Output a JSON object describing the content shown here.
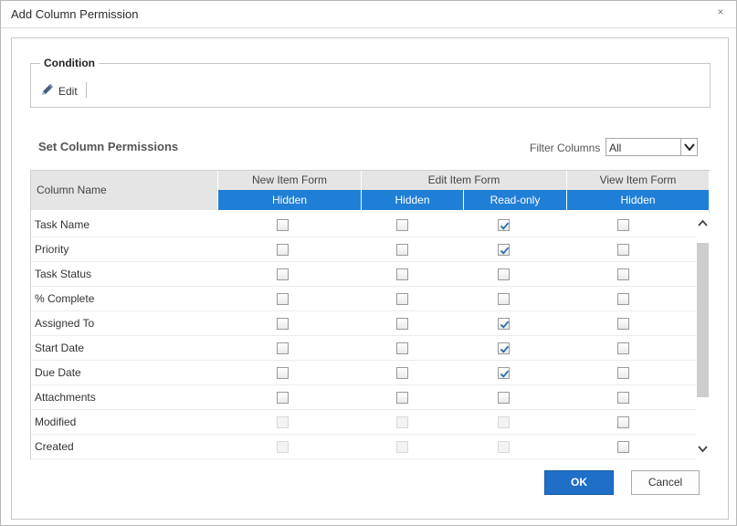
{
  "dialog": {
    "title": "Add Column Permission",
    "close_glyph": "×"
  },
  "condition": {
    "legend": "Condition",
    "edit_label": "Edit",
    "edit_icon": "pencil-icon"
  },
  "section": {
    "title": "Set Column Permissions",
    "filter_label": "Filter Columns",
    "filter_value": "All"
  },
  "grid": {
    "column_name_header": "Column Name",
    "groups": [
      "New Item Form",
      "Edit Item Form",
      "View Item Form"
    ],
    "subheaders": [
      "Hidden",
      "Hidden",
      "Read-only",
      "Hidden"
    ],
    "rows": [
      {
        "label": "Task Name",
        "checks": [
          false,
          false,
          true,
          false
        ],
        "disabled": [
          false,
          false,
          false,
          false
        ]
      },
      {
        "label": "Priority",
        "checks": [
          false,
          false,
          true,
          false
        ],
        "disabled": [
          false,
          false,
          false,
          false
        ]
      },
      {
        "label": "Task Status",
        "checks": [
          false,
          false,
          false,
          false
        ],
        "disabled": [
          false,
          false,
          false,
          false
        ]
      },
      {
        "label": "% Complete",
        "checks": [
          false,
          false,
          false,
          false
        ],
        "disabled": [
          false,
          false,
          false,
          false
        ]
      },
      {
        "label": "Assigned To",
        "checks": [
          false,
          false,
          true,
          false
        ],
        "disabled": [
          false,
          false,
          false,
          false
        ]
      },
      {
        "label": "Start Date",
        "checks": [
          false,
          false,
          true,
          false
        ],
        "disabled": [
          false,
          false,
          false,
          false
        ]
      },
      {
        "label": "Due Date",
        "checks": [
          false,
          false,
          true,
          false
        ],
        "disabled": [
          false,
          false,
          false,
          false
        ]
      },
      {
        "label": "Attachments",
        "checks": [
          false,
          false,
          false,
          false
        ],
        "disabled": [
          false,
          false,
          false,
          false
        ]
      },
      {
        "label": "Modified",
        "checks": [
          false,
          false,
          false,
          false
        ],
        "disabled": [
          true,
          true,
          true,
          false
        ]
      },
      {
        "label": "Created",
        "checks": [
          false,
          false,
          false,
          false
        ],
        "disabled": [
          true,
          true,
          true,
          false
        ]
      }
    ]
  },
  "buttons": {
    "ok_label": "OK",
    "cancel_label": "Cancel"
  },
  "colors": {
    "accent": "#1f7fd6",
    "ok_button": "#1f6fc8",
    "header_gray": "#e5e5e5",
    "check_blue": "#2a6ab0"
  }
}
